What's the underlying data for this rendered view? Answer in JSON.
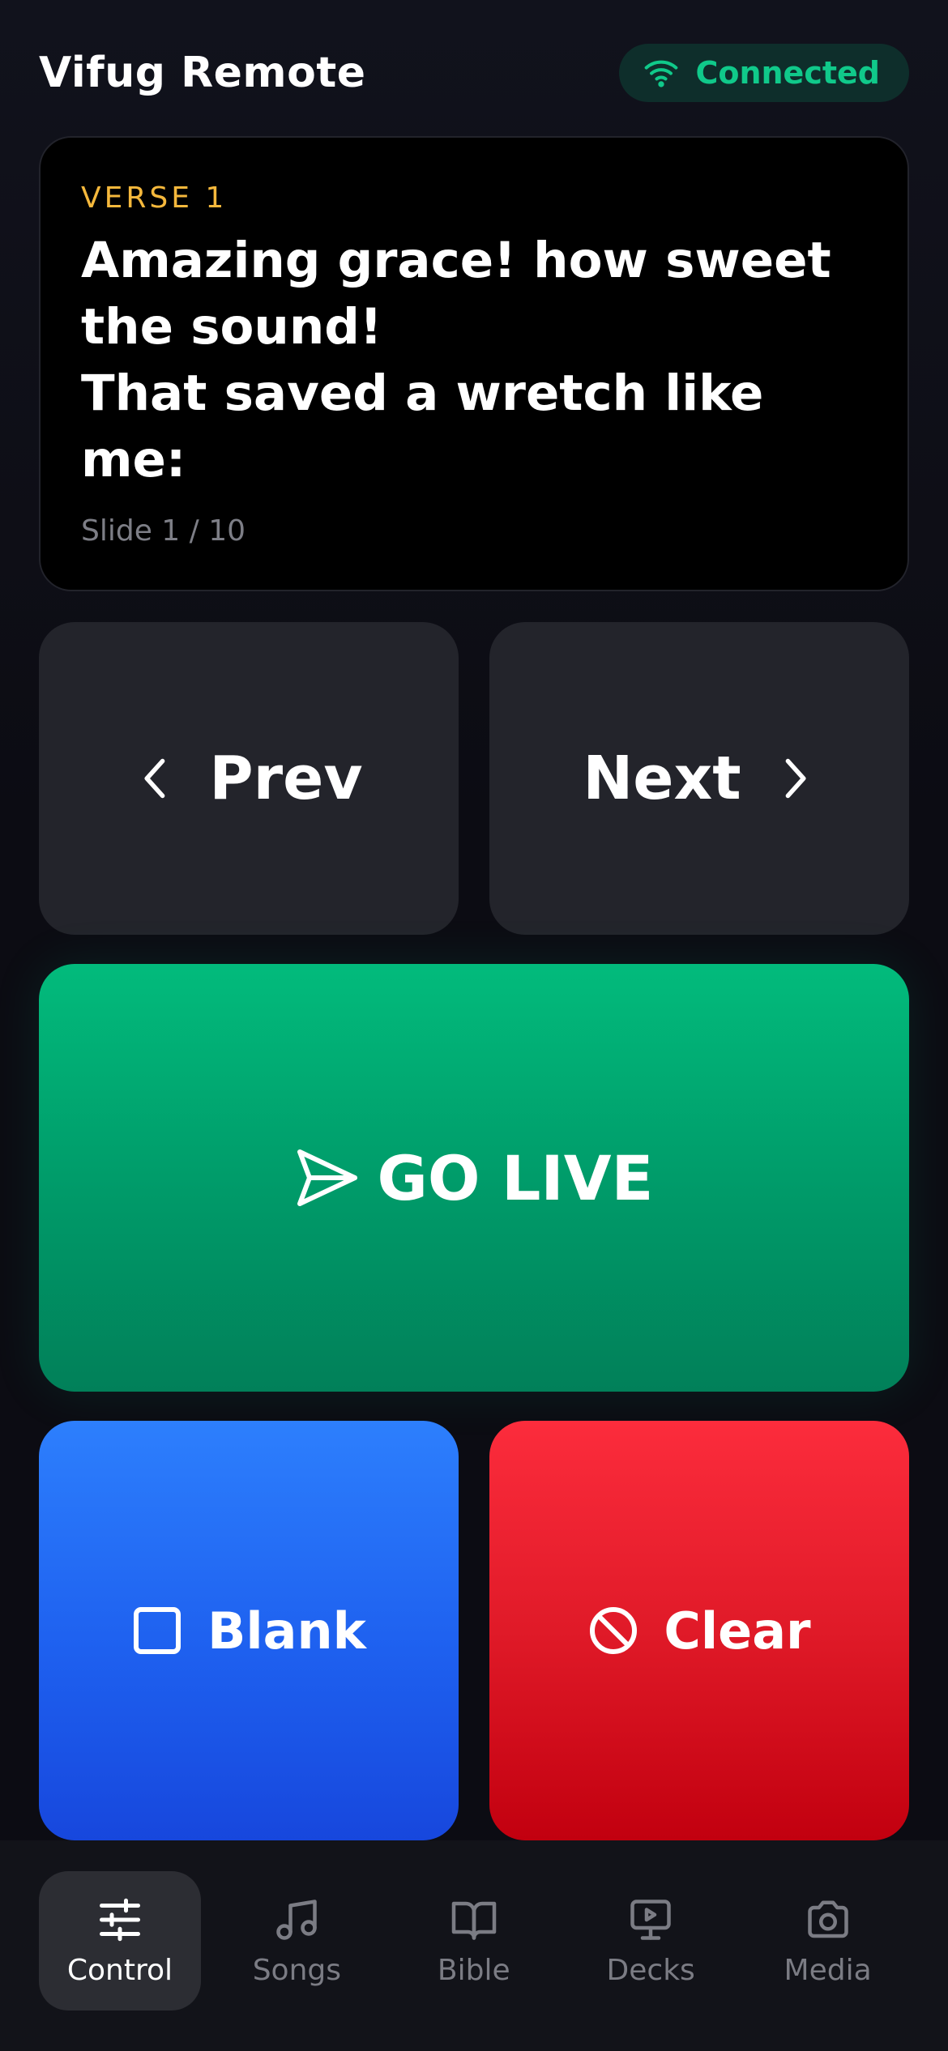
{
  "header": {
    "title": "Vifug Remote",
    "status": "Connected"
  },
  "preview": {
    "verse_label": "VERSE 1",
    "lyrics": "Amazing grace! how sweet\nthe sound!\nThat saved a wretch like\nme:",
    "slide_count": "Slide 1 / 10"
  },
  "controls": {
    "prev_label": "Prev",
    "next_label": "Next",
    "live_label": "GO LIVE",
    "blank_label": "Blank",
    "clear_label": "Clear"
  },
  "tabs": [
    {
      "label": "Control",
      "icon": "sliders-icon",
      "active": true
    },
    {
      "label": "Songs",
      "icon": "music-note-icon",
      "active": false
    },
    {
      "label": "Bible",
      "icon": "book-icon",
      "active": false
    },
    {
      "label": "Decks",
      "icon": "presentation-icon",
      "active": false
    },
    {
      "label": "Media",
      "icon": "camera-icon",
      "active": false
    }
  ],
  "colors": {
    "accent_green": "#02bb7c",
    "status_green": "#10c98a",
    "verse_gold": "#f5b83c",
    "blank_blue": "#2d7ffd",
    "clear_red": "#fc2c3c"
  }
}
